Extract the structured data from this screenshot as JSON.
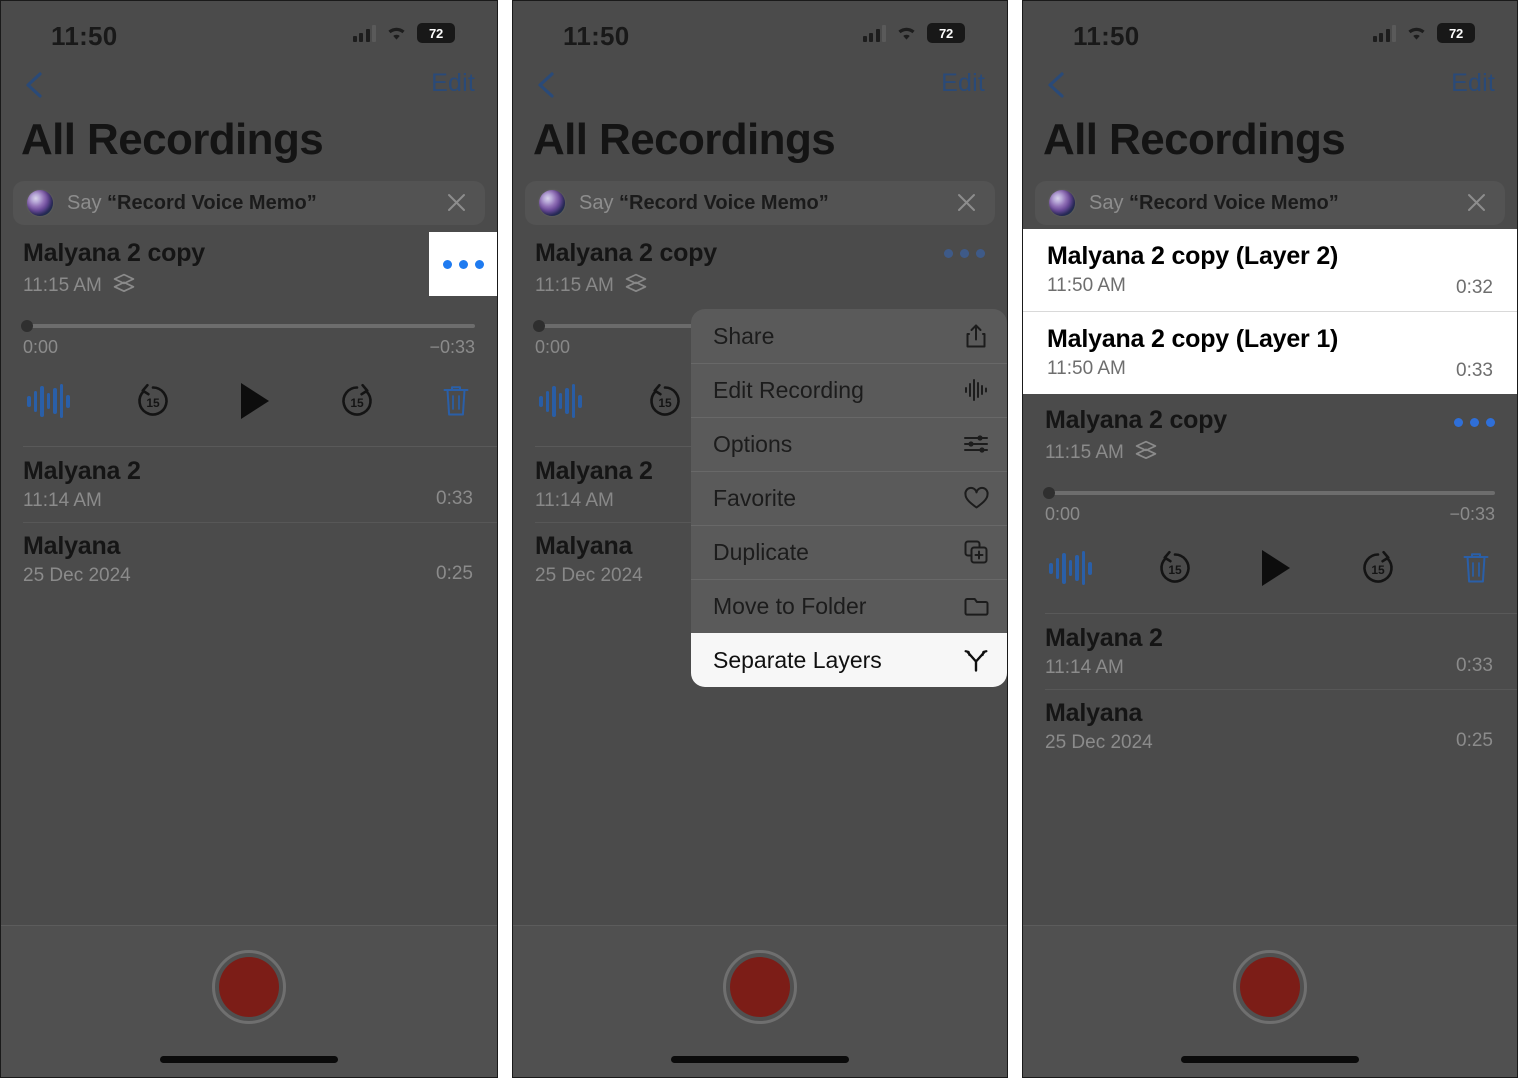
{
  "status_bar": {
    "time": "11:50",
    "battery_percent": "72",
    "signal_icon": "cellular-bars-icon",
    "wifi_icon": "wifi-icon",
    "battery_icon": "battery-icon"
  },
  "nav": {
    "back_icon": "back-chevron-icon",
    "edit_label": "Edit"
  },
  "page_title": "All Recordings",
  "siri": {
    "prefix": "Say ",
    "quoted": "“Record Voice Memo”",
    "orb_icon": "siri-orb-icon",
    "close_icon": "close-icon"
  },
  "recordings": [
    {
      "title": "Malyana 2 copy",
      "time": "11:15 AM",
      "duration": "",
      "has_layers_icon": true
    },
    {
      "title": "Malyana 2",
      "time": "11:14 AM",
      "duration": "0:33",
      "has_layers_icon": false
    },
    {
      "title": "Malyana",
      "time": "25 Dec 2024",
      "duration": "0:25",
      "has_layers_icon": false
    }
  ],
  "player": {
    "elapsed": "0:00",
    "remaining": "−0:33",
    "progress_percent": 0,
    "waveform_icon": "waveform-icon",
    "skip_back_icon": "skip-back-15-icon",
    "skip_back_label": "15",
    "play_icon": "play-icon",
    "skip_forward_icon": "skip-forward-15-icon",
    "skip_forward_label": "15",
    "delete_icon": "trash-icon"
  },
  "context_menu": {
    "items": [
      {
        "label": "Share",
        "icon": "share-icon",
        "highlighted": false
      },
      {
        "label": "Edit Recording",
        "icon": "waveform-icon",
        "highlighted": false
      },
      {
        "label": "Options",
        "icon": "sliders-icon",
        "highlighted": false
      },
      {
        "label": "Favorite",
        "icon": "heart-icon",
        "highlighted": false
      },
      {
        "label": "Duplicate",
        "icon": "duplicate-icon",
        "highlighted": false
      },
      {
        "label": "Move to Folder",
        "icon": "folder-icon",
        "highlighted": false
      },
      {
        "label": "Separate Layers",
        "icon": "split-branch-icon",
        "highlighted": true
      }
    ]
  },
  "separated_layers": [
    {
      "title": "Malyana 2 copy (Layer 2)",
      "time": "11:50 AM",
      "duration": "0:32"
    },
    {
      "title": "Malyana 2 copy (Layer 1)",
      "time": "11:50 AM",
      "duration": "0:33"
    }
  ],
  "record_button": {
    "icon": "record-button-icon",
    "color": "#7c1d17"
  },
  "colors": {
    "accent_blue": "#2f6fd8",
    "dim_background": "#4b4b4b",
    "highlight_white": "#ffffff",
    "menu_background": "#5a5a5a"
  },
  "overflow_label": "more-options-icon",
  "home_indicator": "home-indicator"
}
